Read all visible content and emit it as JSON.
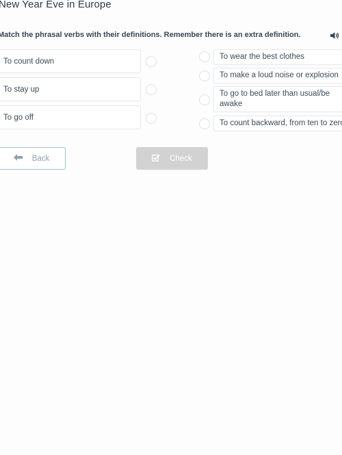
{
  "page": {
    "title": "New Year Eve in Europe",
    "instruction": "Match the phrasal verbs with their definitions. Remember there is an extra definition.",
    "sound_icon": "speaker-icon"
  },
  "left_items": [
    {
      "label": "To count down"
    },
    {
      "label": "To stay up"
    },
    {
      "label": "To go off"
    }
  ],
  "right_items": [
    {
      "label": "To wear the best clothes"
    },
    {
      "label": "To make a loud noise or explosion"
    },
    {
      "label": "To go to bed later than usual/be awake"
    },
    {
      "label": "To count backward, from ten to zero"
    }
  ],
  "buttons": {
    "back_label": "Back",
    "back_icon": "arrow-left-icon",
    "check_label": "Check",
    "check_icon": "checkbox-icon"
  }
}
